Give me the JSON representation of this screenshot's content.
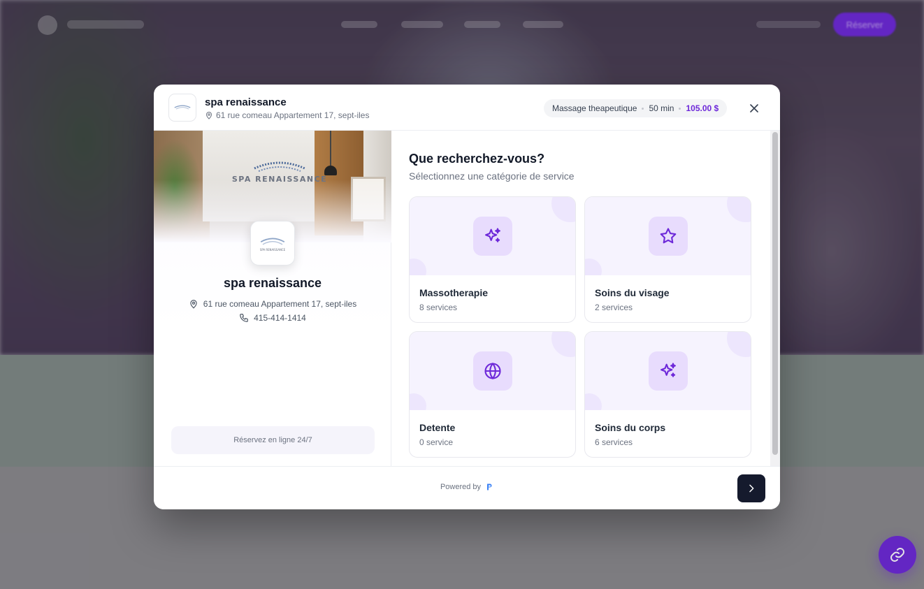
{
  "background": {
    "cta_label": "Réserver"
  },
  "modal": {
    "header": {
      "name": "spa renaissance",
      "address": "61 rue comeau Appartement 17, sept-iles",
      "selected_service": {
        "name": "Massage theapeutique",
        "duration": "50 min",
        "price": "105.00 $"
      }
    },
    "profile": {
      "photo_sign": "SPA RENAISSANCE",
      "logo_text": "SPA RENAISSANCE",
      "name": "spa renaissance",
      "address": "61 rue comeau Appartement 17, sept-iles",
      "phone": "415-414-1414",
      "badge": "Réservez en ligne 24/7"
    },
    "content": {
      "title": "Que recherchez-vous?",
      "subtitle": "Sélectionnez une catégorie de service",
      "categories": [
        {
          "name": "Massotherapie",
          "count": "8 services",
          "icon": "sparkles-icon"
        },
        {
          "name": "Soins du visage",
          "count": "2 services",
          "icon": "star-icon"
        },
        {
          "name": "Detente",
          "count": "0 service",
          "icon": "globe-icon"
        },
        {
          "name": "Soins du corps",
          "count": "6 services",
          "icon": "sparkles-icon"
        }
      ]
    },
    "footer": {
      "powered_by": "Powered by"
    }
  },
  "colors": {
    "accent": "#6d28d9",
    "card_top": "#f6f3fe",
    "icon_bg": "#e8dcfd",
    "next_button": "#151a2d"
  }
}
